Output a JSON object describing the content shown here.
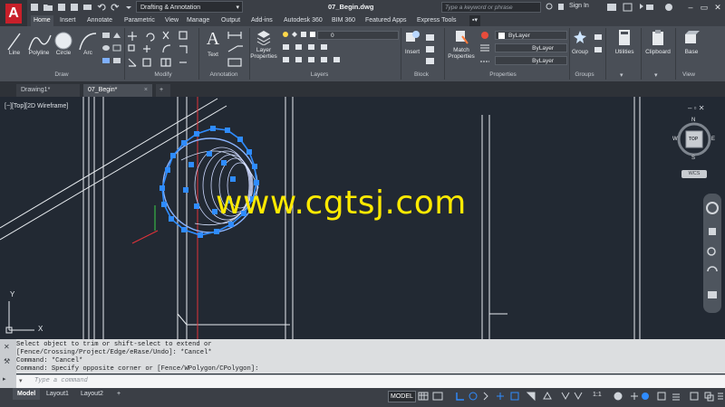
{
  "titlebar": {
    "workspace": "Drafting & Annotation",
    "doc_title": "07_Begin.dwg",
    "search_placeholder": "Type a keyword or phrase",
    "signin": "Sign In"
  },
  "ribbon_tabs": [
    "Home",
    "Insert",
    "Annotate",
    "Parametric",
    "View",
    "Manage",
    "Output",
    "Add-ins",
    "Autodesk 360",
    "BIM 360",
    "Featured Apps",
    "Express Tools"
  ],
  "draw_panel": {
    "title": "Draw",
    "line": "Line",
    "polyline": "Polyline",
    "circle": "Circle",
    "arc": "Arc"
  },
  "modify_panel": {
    "title": "Modify"
  },
  "annotation_panel": {
    "title": "Annotation",
    "text": "Text"
  },
  "layers_panel": {
    "title": "Layers",
    "layer_properties": "Layer\nProperties",
    "layer_props_l1": "Layer",
    "layer_props_l2": "Properties",
    "current_layer": "0"
  },
  "block_panel": {
    "title": "Block",
    "insert": "Insert"
  },
  "properties_panel": {
    "title": "Properties",
    "match_l1": "Match",
    "match_l2": "Properties",
    "color": "ByLayer",
    "lineweight": "ByLayer",
    "linetype": "ByLayer"
  },
  "groups_panel": {
    "title": "Groups",
    "group": "Group"
  },
  "utilities_panel": {
    "utilities": "Utilities"
  },
  "clipboard_panel": {
    "clipboard": "Clipboard"
  },
  "view_panel": {
    "title": "View",
    "base": "Base"
  },
  "file_tabs": [
    "Drawing1*",
    "07_Begin*"
  ],
  "viewport_label": "[−][Top][2D Wireframe]",
  "viewcube": {
    "top": "TOP",
    "n": "N",
    "s": "S",
    "e": "E",
    "w": "W",
    "wcs": "WCS"
  },
  "ucs": {
    "x": "X",
    "y": "Y"
  },
  "watermark": "www.cgtsj.com",
  "command_history": [
    "Select object to trim or shift-select to extend or",
    "[Fence/Crossing/Project/Edge/eRase/Undo]: *Cancel*",
    "Command: *Cancel*",
    "Command: Specify opposite corner or [Fence/WPolygon/CPolygon]:"
  ],
  "command_placeholder": "Type a command",
  "layout_tabs": [
    "Model",
    "Layout1",
    "Layout2"
  ],
  "status": {
    "model": "MODEL",
    "scale": "1:1"
  },
  "colors": {
    "accent": "#c8202a",
    "selection": "#2f8cff",
    "watermark": "#ffea00"
  }
}
